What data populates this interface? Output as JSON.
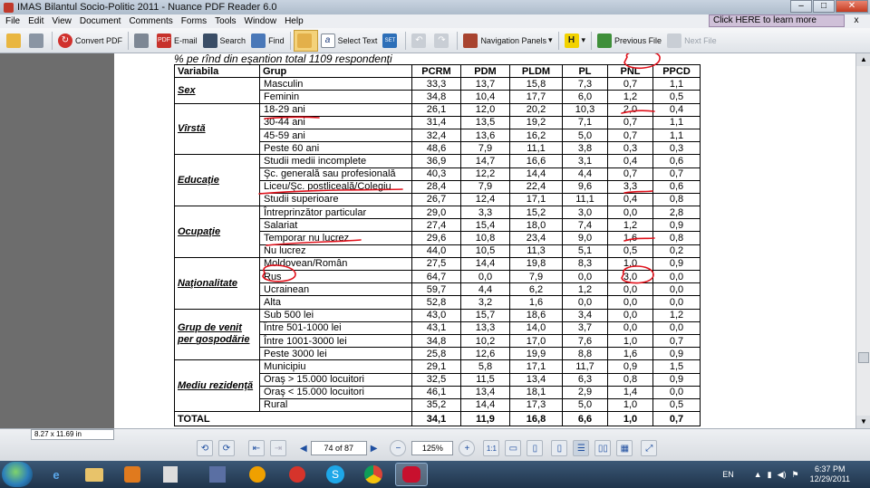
{
  "window": {
    "title": "IMAS Bilantul Socio-Politic 2011 - Nuance PDF Reader 6.0",
    "min": "–",
    "max": "□",
    "close": "✕"
  },
  "menu": [
    "File",
    "Edit",
    "View",
    "Document",
    "Comments",
    "Forms",
    "Tools",
    "Window",
    "Help"
  ],
  "promo": {
    "text": "Click HERE to learn more",
    "close": "x"
  },
  "toolbar": {
    "convert_pdf": "Convert PDF",
    "email": "E-mail",
    "search": "Search",
    "find": "Find",
    "select_text": "Select Text",
    "navigation_panels": "Navigation Panels",
    "previous_file": "Previous File",
    "next_file": "Next File",
    "email_icon_text": "PDF",
    "set_icon_text": "SET"
  },
  "document": {
    "note": "% pe rînd din eşantion total 1109 respondenţi",
    "headers": [
      "Variabila",
      "Grup",
      "PCRM",
      "PDM",
      "PLDM",
      "PL",
      "PNL",
      "PPCD"
    ],
    "sections": [
      {
        "label": "Sex",
        "rows": [
          {
            "group": "Masculin",
            "values": [
              "33,3",
              "13,7",
              "15,8",
              "7,3",
              "0,7",
              "1,1"
            ]
          },
          {
            "group": "Feminin",
            "values": [
              "34,8",
              "10,4",
              "17,7",
              "6,0",
              "1,2",
              "0,5"
            ]
          }
        ]
      },
      {
        "label": "Vîrstă",
        "rows": [
          {
            "group": "18-29 ani",
            "values": [
              "26,1",
              "12,0",
              "20,2",
              "10,3",
              "2,0",
              "0,4"
            ]
          },
          {
            "group": "30-44 ani",
            "values": [
              "31,4",
              "13,5",
              "19,2",
              "7,1",
              "0,7",
              "1,1"
            ]
          },
          {
            "group": "45-59 ani",
            "values": [
              "32,4",
              "13,6",
              "16,2",
              "5,0",
              "0,7",
              "1,1"
            ]
          },
          {
            "group": "Peste 60 ani",
            "values": [
              "48,6",
              "7,9",
              "11,1",
              "3,8",
              "0,3",
              "0,3"
            ]
          }
        ]
      },
      {
        "label": "Educaţie",
        "rows": [
          {
            "group": "Studii medii incomplete",
            "values": [
              "36,9",
              "14,7",
              "16,6",
              "3,1",
              "0,4",
              "0,6"
            ]
          },
          {
            "group": "Şc. generală sau profesională",
            "values": [
              "40,3",
              "12,2",
              "14,4",
              "4,4",
              "0,7",
              "0,7"
            ]
          },
          {
            "group": "Liceu/Şc. postliceală/Colegiu",
            "values": [
              "28,4",
              "7,9",
              "22,4",
              "9,6",
              "3,3",
              "0,6"
            ]
          },
          {
            "group": "Studii superioare",
            "values": [
              "26,7",
              "12,4",
              "17,1",
              "11,1",
              "0,4",
              "0,8"
            ]
          }
        ]
      },
      {
        "label": "Ocupaţie",
        "rows": [
          {
            "group": "Întreprinzător particular",
            "values": [
              "29,0",
              "3,3",
              "15,2",
              "3,0",
              "0,0",
              "2,8"
            ]
          },
          {
            "group": "Salariat",
            "values": [
              "27,4",
              "15,4",
              "18,0",
              "7,4",
              "1,2",
              "0,9"
            ]
          },
          {
            "group": "Temporar nu lucrez",
            "values": [
              "29,6",
              "10,8",
              "23,4",
              "9,0",
              "1,6",
              "0,8"
            ]
          },
          {
            "group": "Nu lucrez",
            "values": [
              "44,0",
              "10,5",
              "11,3",
              "5,1",
              "0,5",
              "0,2"
            ]
          }
        ]
      },
      {
        "label": "Naţionalitate",
        "rows": [
          {
            "group": "Moldovean/Român",
            "values": [
              "27,5",
              "14,4",
              "19,8",
              "8,3",
              "1,0",
              "0,9"
            ]
          },
          {
            "group": "Rus",
            "values": [
              "64,7",
              "0,0",
              "7,9",
              "0,0",
              "3,0",
              "0,0"
            ]
          },
          {
            "group": "Ucrainean",
            "values": [
              "59,7",
              "4,4",
              "6,2",
              "1,2",
              "0,0",
              "0,0"
            ]
          },
          {
            "group": "Alta",
            "values": [
              "52,8",
              "3,2",
              "1,6",
              "0,0",
              "0,0",
              "0,0"
            ]
          }
        ]
      },
      {
        "label": "Grup de venit per gospodărie",
        "rows": [
          {
            "group": "Sub 500 lei",
            "values": [
              "43,0",
              "15,7",
              "18,6",
              "3,4",
              "0,0",
              "1,2"
            ]
          },
          {
            "group": "Între 501-1000 lei",
            "values": [
              "43,1",
              "13,3",
              "14,0",
              "3,7",
              "0,0",
              "0,0"
            ]
          },
          {
            "group": "Între 1001-3000 lei",
            "values": [
              "34,8",
              "10,2",
              "17,0",
              "7,6",
              "1,0",
              "0,7"
            ]
          },
          {
            "group": "Peste 3000 lei",
            "values": [
              "25,8",
              "12,6",
              "19,9",
              "8,8",
              "1,6",
              "0,9"
            ]
          }
        ]
      },
      {
        "label": "Mediu rezidenţă",
        "rows": [
          {
            "group": "Municipiu",
            "values": [
              "29,1",
              "5,8",
              "17,1",
              "11,7",
              "0,9",
              "1,5"
            ]
          },
          {
            "group": "Oraş > 15.000 locuitori",
            "values": [
              "32,5",
              "11,5",
              "13,4",
              "6,3",
              "0,8",
              "0,9"
            ]
          },
          {
            "group": "Oraş < 15.000 locuitori",
            "values": [
              "46,1",
              "13,4",
              "18,1",
              "2,9",
              "1,4",
              "0,0"
            ]
          },
          {
            "group": "Rural",
            "values": [
              "35,2",
              "14,4",
              "17,3",
              "5,0",
              "1,0",
              "0,5"
            ]
          }
        ]
      }
    ],
    "total": {
      "label": "TOTAL",
      "values": [
        "34,1",
        "11,9",
        "16,8",
        "6,6",
        "1,0",
        "0,7"
      ]
    }
  },
  "status": {
    "page_size": "8.27 x 11.69 in",
    "page_indicator": "74 of 87",
    "zoom": "125%"
  },
  "taskbar": {
    "lang": "EN",
    "time": "6:37 PM",
    "date": "12/29/2011"
  },
  "colors": {
    "annotation_red": "#e0101a",
    "promo_bg": "#cfc0d8"
  }
}
